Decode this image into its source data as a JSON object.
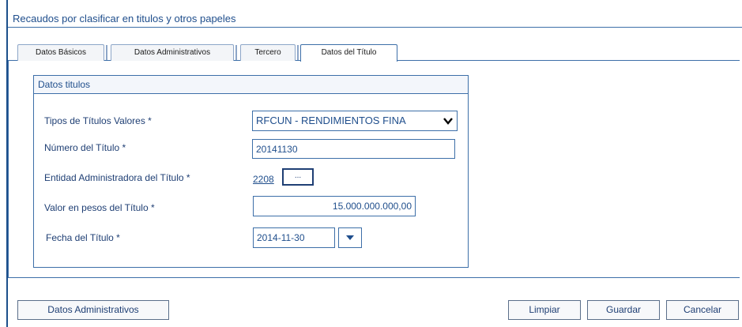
{
  "window": {
    "title": "Recaudos por clasificar en titulos y otros papeles"
  },
  "tabs": [
    {
      "label": "Datos Básicos"
    },
    {
      "label": "Datos Administrativos"
    },
    {
      "label": "Tercero"
    },
    {
      "label": "Datos del Título"
    }
  ],
  "active_tab": "Datos del Título",
  "section": {
    "title": "Datos titulos"
  },
  "form": {
    "tipo_titulo": {
      "label": "Tipos de Títulos Valores *",
      "value": "RFCUN - RENDIMIENTOS FINA"
    },
    "numero_titulo": {
      "label": "Número del Título *",
      "value": "20141130"
    },
    "entidad": {
      "label": "Entidad Administradora del Título *",
      "value": "2208",
      "button": "..."
    },
    "valor": {
      "label": "Valor en pesos del Título *",
      "value": "15.000.000.000,00"
    },
    "fecha": {
      "label": "Fecha del Título *",
      "value": "2014-11-30"
    }
  },
  "buttons": {
    "datos_admin": "Datos Administrativos",
    "limpiar": "Limpiar",
    "guardar": "Guardar",
    "cancelar": "Cancelar"
  },
  "colors": {
    "accent": "#1f4e8c",
    "border": "#3d6fa8"
  }
}
